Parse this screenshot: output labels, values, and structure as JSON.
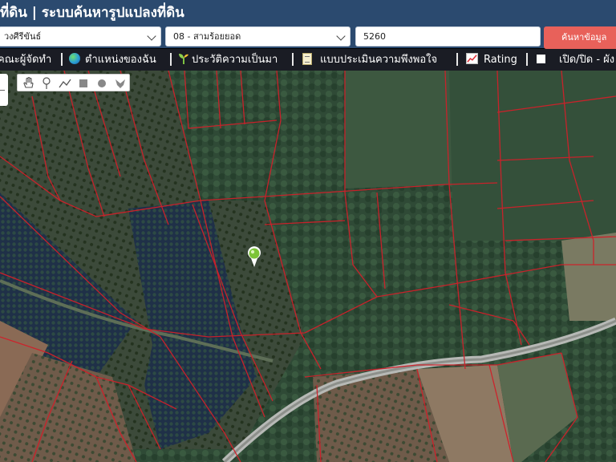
{
  "header": {
    "title": "ที่ดิน | ระบบค้นหารูปแปลงที่ดิน"
  },
  "search": {
    "province_value": "วงศีรีขันธ์",
    "district_value": "08 - สามร้อยยอด",
    "parcel_value": "5260",
    "button_label": "ค้นหาข้อมูล"
  },
  "nav": {
    "item1": "คณะผู้จัดทำ",
    "item2": "ตำแหน่งของฉัน",
    "item3": "ประวัติความเป็นมา",
    "item4": "แบบประเมินความพึงพอใจ",
    "item5": "Rating",
    "item6": "เปิด/ปิด - ผัง"
  },
  "map_tools": [
    "hand-icon",
    "point-icon",
    "line-icon",
    "rectangle-icon",
    "circle-icon",
    "freehand-icon"
  ],
  "colors": {
    "header_bg": "#2b4a6f",
    "nav_bg": "#1a1c24",
    "search_button": "#e8615a",
    "parcel_line": "#d0202a"
  }
}
